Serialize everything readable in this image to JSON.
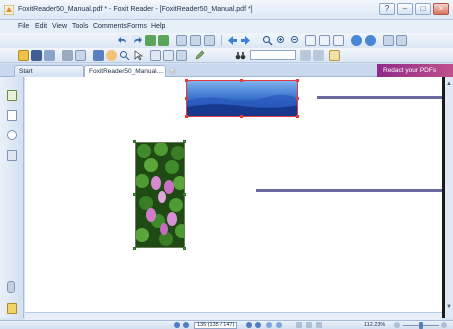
{
  "window": {
    "title": "FoxitReader50_Manual.pdf * - Foxit Reader - [FoxitReader50_Manual.pdf *]",
    "controls": [
      "?",
      "–",
      "□",
      "×"
    ]
  },
  "menu": [
    "File",
    "Edit",
    "View",
    "Tools",
    "Comments",
    "Forms",
    "Help"
  ],
  "tabs": [
    {
      "label": "Start",
      "active": false
    },
    {
      "label": "FoxitReader50_Manual....",
      "active": true
    }
  ],
  "promo": {
    "label": "Redact your PDFs"
  },
  "status": {
    "page_display": "135 (135 / 147)",
    "zoom": "112.23%"
  },
  "colors": {
    "selection_border": "#e23b3b",
    "callout_line": "#6b6aa1",
    "accent": "#3f78d0"
  }
}
